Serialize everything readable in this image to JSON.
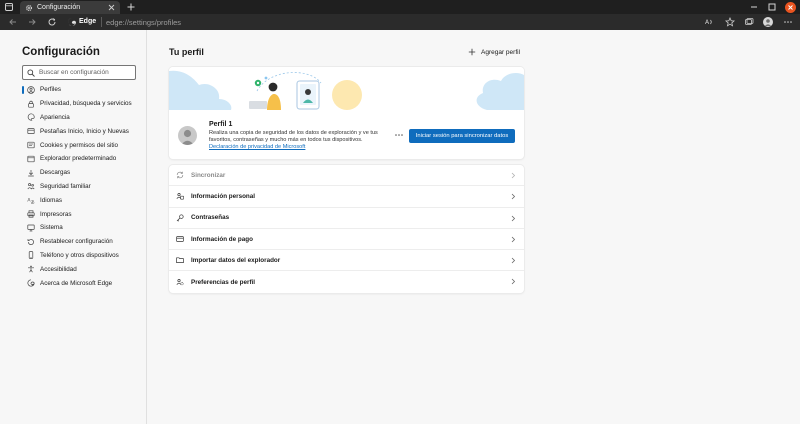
{
  "browser": {
    "tab_title": "Configuración",
    "address_brand": "Edge",
    "address_url": "edge://settings/profiles",
    "colors": {
      "titlebar": "#1f1f1f",
      "tab_active": "#3b3b3b",
      "close_button": "#e95420"
    }
  },
  "sidebar": {
    "title": "Configuración",
    "search_placeholder": "Buscar en configuración",
    "items": [
      {
        "label": "Perfiles",
        "icon": "profile-icon",
        "active": true
      },
      {
        "label": "Privacidad, búsqueda y servicios",
        "icon": "lock-icon"
      },
      {
        "label": "Apariencia",
        "icon": "palette-icon"
      },
      {
        "label": "Pestañas Inicio, Inicio y Nuevas",
        "icon": "tabs-icon"
      },
      {
        "label": "Cookies y permisos del sitio",
        "icon": "cookie-icon"
      },
      {
        "label": "Explorador predeterminado",
        "icon": "browser-icon"
      },
      {
        "label": "Descargas",
        "icon": "download-icon"
      },
      {
        "label": "Seguridad familiar",
        "icon": "family-icon"
      },
      {
        "label": "Idiomas",
        "icon": "language-icon"
      },
      {
        "label": "Impresoras",
        "icon": "printer-icon"
      },
      {
        "label": "Sistema",
        "icon": "system-icon"
      },
      {
        "label": "Restablecer configuración",
        "icon": "reset-icon"
      },
      {
        "label": "Teléfono y otros dispositivos",
        "icon": "phone-icon"
      },
      {
        "label": "Accesibilidad",
        "icon": "accessibility-icon"
      },
      {
        "label": "Acerca de Microsoft Edge",
        "icon": "edge-icon"
      }
    ]
  },
  "main": {
    "title": "Tu perfil",
    "add_profile": "Agregar perfil",
    "profile": {
      "name": "Perfil 1",
      "description": "Realiza una copia de seguridad de los datos de exploración y ve tus favoritos, contraseñas y mucho más en todos tus dispositivos.",
      "privacy_link": "Declaración de privacidad de Microsoft",
      "signin_button": "Iniciar sesión para sincronizar datos"
    },
    "settings_rows": [
      {
        "label": "Sincronizar",
        "icon": "sync-icon",
        "disabled": true
      },
      {
        "label": "Información personal",
        "icon": "person-card-icon"
      },
      {
        "label": "Contraseñas",
        "icon": "key-icon"
      },
      {
        "label": "Información de pago",
        "icon": "credit-card-icon"
      },
      {
        "label": "Importar datos del explorador",
        "icon": "import-folder-icon"
      },
      {
        "label": "Preferencias de perfil",
        "icon": "profile-settings-icon"
      }
    ]
  },
  "colors": {
    "accent": "#0f6cbd",
    "page_bg": "#f7f7f7",
    "card_bg": "#ffffff"
  }
}
